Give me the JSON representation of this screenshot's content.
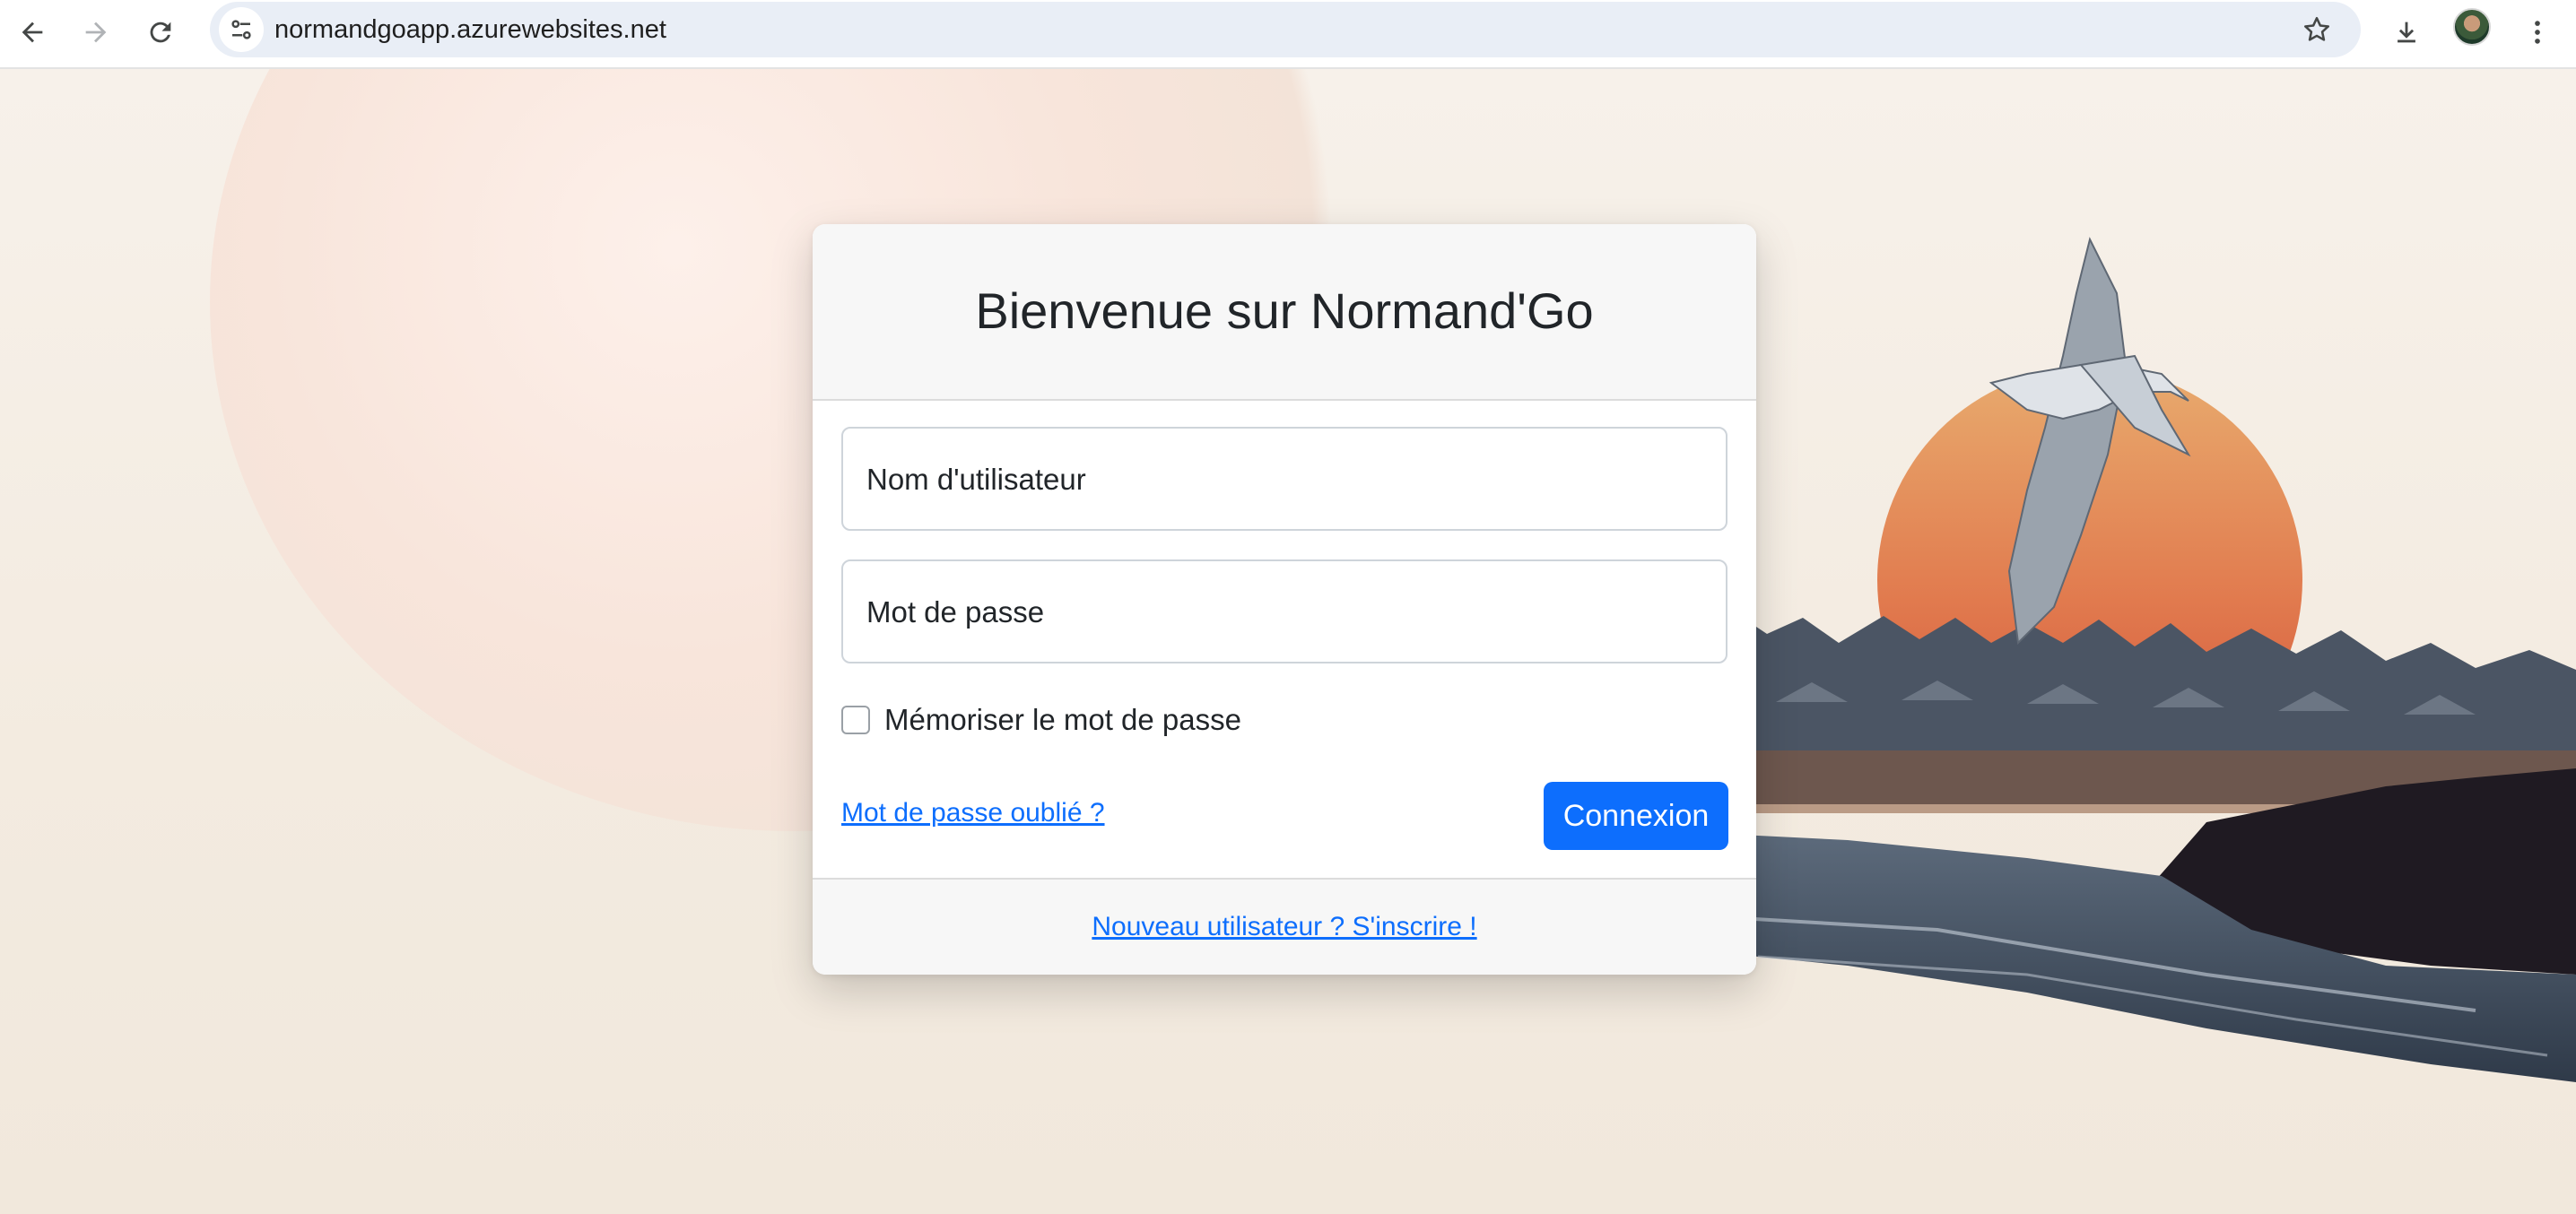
{
  "browser": {
    "url": "normandgoapp.azurewebsites.net"
  },
  "login": {
    "title": "Bienvenue sur Normand'Go",
    "username_label": "Nom d'utilisateur",
    "password_label": "Mot de passe",
    "remember_label": "Mémoriser le mot de passe",
    "remember_checked": false,
    "forgot_link": "Mot de passe oublié ?",
    "submit_label": "Connexion",
    "signup_link": "Nouveau utilisateur ? S'inscrire !"
  },
  "icons": [
    "back-arrow-icon",
    "forward-arrow-icon",
    "reload-icon",
    "site-info-icon",
    "bookmark-star-icon",
    "download-icon",
    "more-vert-icon"
  ],
  "colors": {
    "primary": "#0d6efd",
    "card_header": "#f7f7f7",
    "page_background": "#f3ebe0",
    "sun": "#e0643f"
  }
}
